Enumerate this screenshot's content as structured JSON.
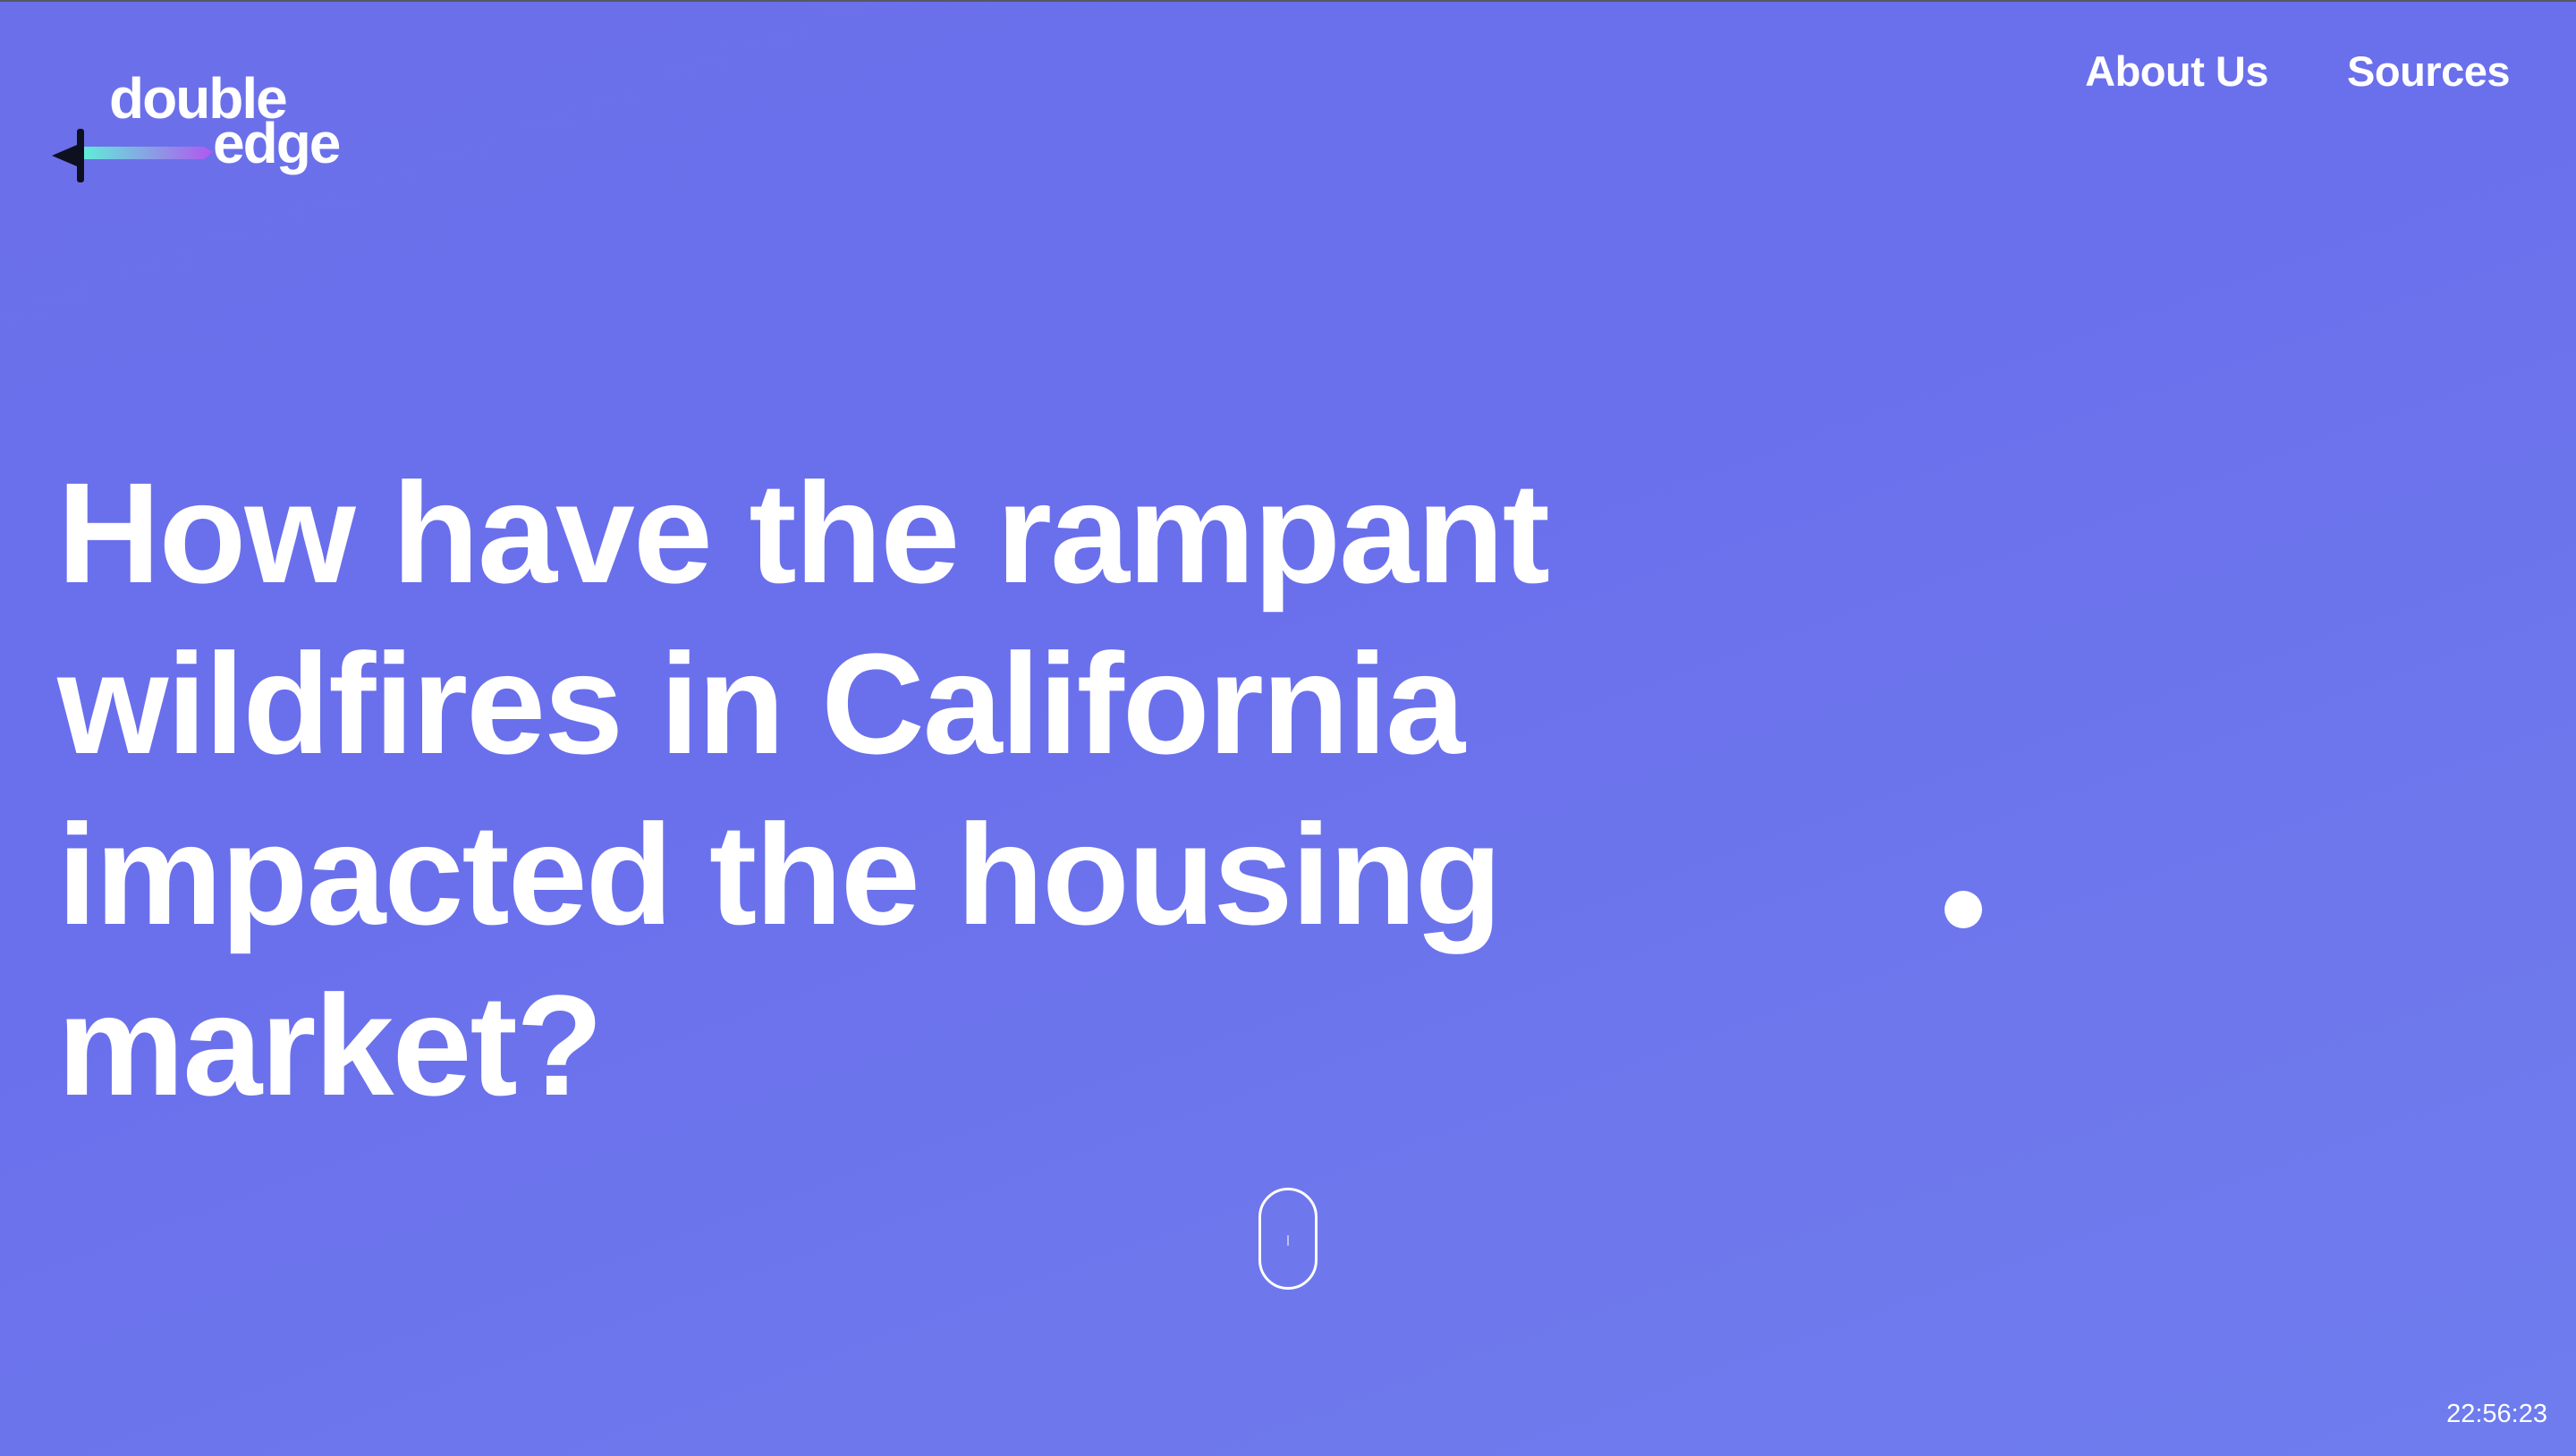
{
  "logo": {
    "word1": "double",
    "word2": "edge"
  },
  "nav": {
    "items": [
      {
        "label": "About Us"
      },
      {
        "label": "Sources"
      }
    ]
  },
  "hero": {
    "title": "How have the rampant wildfires in California impacted the housing market?"
  },
  "status": {
    "clock": "22:56:23"
  },
  "colors": {
    "background_start": "#6b70ea",
    "background_end": "#6e7cee",
    "text": "#ffffff",
    "logo_gradient_start": "#5ef0d8",
    "logo_gradient_end": "#b157f0"
  },
  "icons": {
    "logo_mark": "sword-icon",
    "scroll": "mouse-scroll-icon"
  }
}
